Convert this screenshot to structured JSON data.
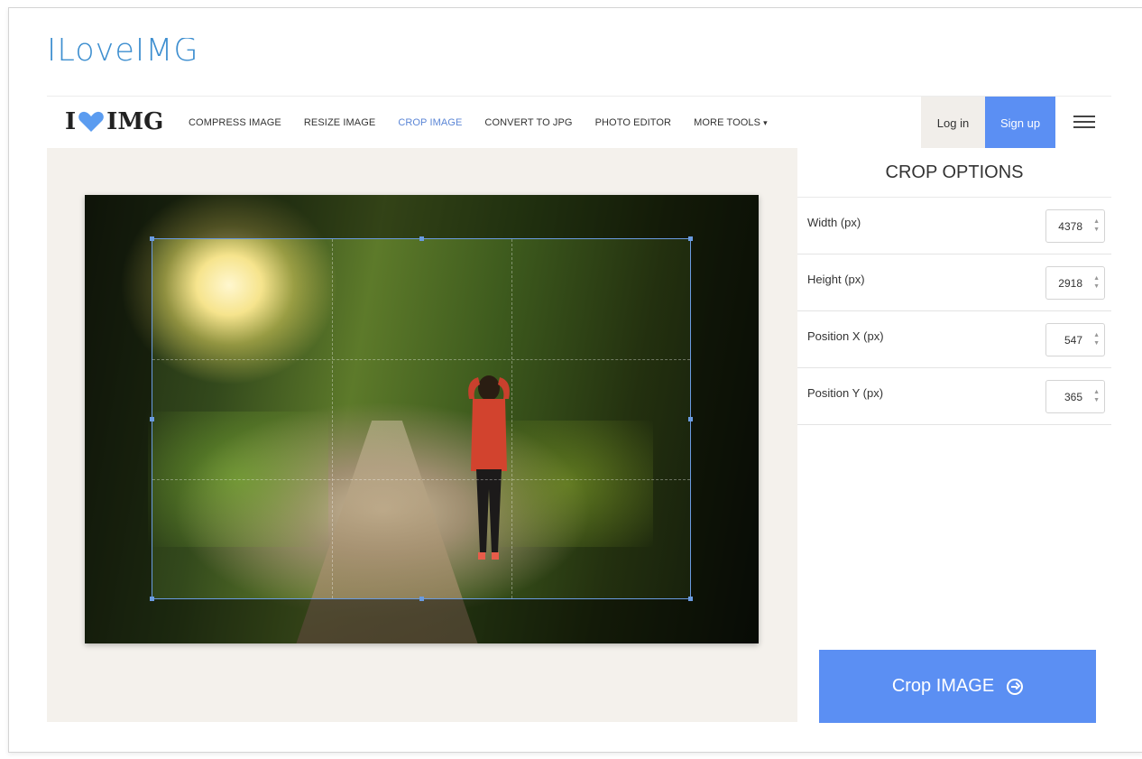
{
  "page": {
    "heading": "ILoveIMG"
  },
  "nav": {
    "logo_left": "I",
    "logo_right": "IMG",
    "items": [
      {
        "label": "COMPRESS IMAGE"
      },
      {
        "label": "RESIZE IMAGE"
      },
      {
        "label": "CROP IMAGE"
      },
      {
        "label": "CONVERT TO JPG"
      },
      {
        "label": "PHOTO EDITOR"
      },
      {
        "label": "MORE TOOLS"
      }
    ],
    "more_caret": "▾",
    "login": "Log in",
    "signup": "Sign up"
  },
  "sidebar": {
    "title": "CROP OPTIONS",
    "options": [
      {
        "label": "Width (px)",
        "value": "4378"
      },
      {
        "label": "Height (px)",
        "value": "2918"
      },
      {
        "label": "Position X (px)",
        "value": "547"
      },
      {
        "label": "Position Y (px)",
        "value": "365"
      }
    ],
    "crop_button": "Crop IMAGE"
  },
  "colors": {
    "accent": "#5b8ff3",
    "active_nav": "#5b86d6",
    "heading": "#3e8fd0",
    "workspace_bg": "#f4f1ec",
    "crop_border": "#6a9be0"
  },
  "icons": {
    "logo": "heart-icon",
    "more_tools": "caret-down-icon",
    "menu": "hamburger-icon",
    "crop_button": "arrow-circle-right-icon",
    "spinner": "spinner-arrows-icon"
  }
}
